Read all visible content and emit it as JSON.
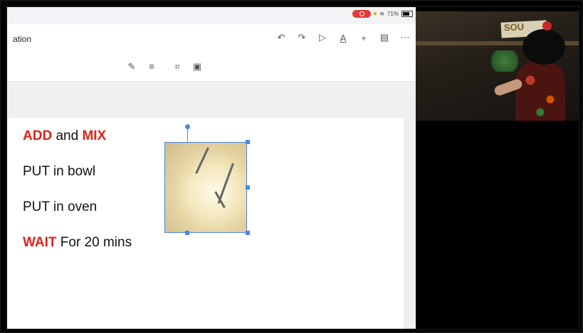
{
  "status_bar": {
    "battery_percent": "71%",
    "icons": [
      "screen-record-icon",
      "wifi-icon",
      "battery-icon"
    ]
  },
  "header": {
    "title_fragment": "ation"
  },
  "toolbar": {
    "icons": [
      "undo-icon",
      "redo-icon",
      "present-icon",
      "text-format-icon",
      "add-icon",
      "comment-icon",
      "more-icon"
    ],
    "glyphs": {
      "undo": "↶",
      "redo": "↷",
      "present": "▷",
      "text_format": "A",
      "add": "+",
      "comment": "▤",
      "more": "⋯"
    }
  },
  "format_bar": {
    "icons": [
      "pencil-icon",
      "align-icon",
      "crop-icon",
      "image-options-icon"
    ],
    "glyphs": {
      "pencil": "✎",
      "align": "≡",
      "crop": "⌗",
      "image_options": "▣"
    }
  },
  "slide": {
    "lines": [
      {
        "highlight1": "ADD",
        "plain1": " and ",
        "highlight2": "MIX"
      },
      {
        "plain": "PUT in bowl"
      },
      {
        "plain": "PUT in oven"
      },
      {
        "highlight": "WAIT",
        "plain": " For 20 mins"
      }
    ],
    "image_description": "whipped-cream-image"
  },
  "video": {
    "sign_text": "SOU"
  },
  "colors": {
    "accent_red": "#e32119",
    "selection_blue": "#4a86e8",
    "record_red": "#e53935"
  }
}
